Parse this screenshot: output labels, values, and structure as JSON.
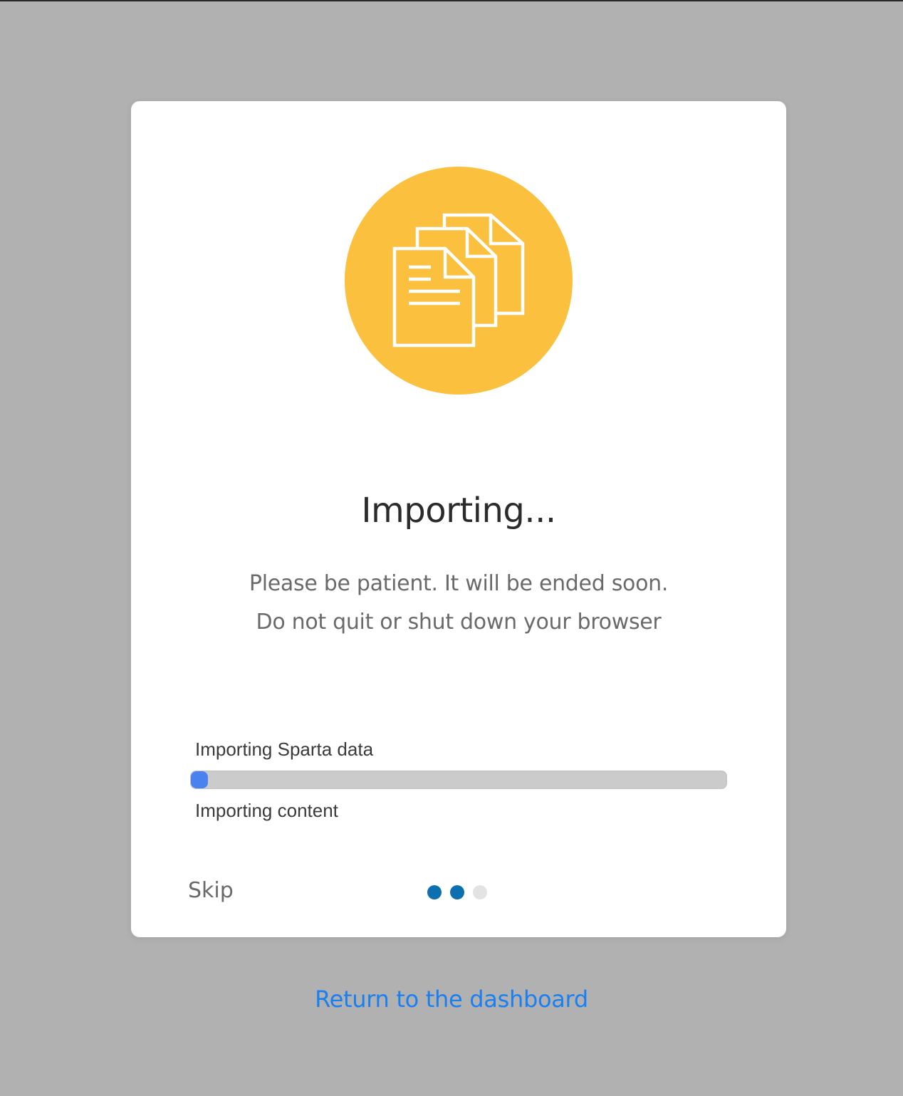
{
  "modal": {
    "icon": "documents-icon",
    "title": "Importing...",
    "subtitle_line1": "Please be patient. It will be ended soon.",
    "subtitle_line2": "Do not quit or shut down your browser",
    "current_step_label": "Importing Sparta data",
    "progress_fraction": 0.03,
    "next_step_label": "Importing content",
    "skip_label": "Skip",
    "pager": {
      "total": 3,
      "active": [
        0,
        1
      ]
    }
  },
  "return_link_label": "Return to the dashboard",
  "colors": {
    "background": "#b1b1b1",
    "icon_circle": "#fbc13e",
    "progress_fill": "#4a83ef",
    "progress_track": "#cbcbcb",
    "dot_active": "#0d6fae",
    "dot_inactive": "#e3e3e3",
    "link": "#1a7ff0"
  }
}
